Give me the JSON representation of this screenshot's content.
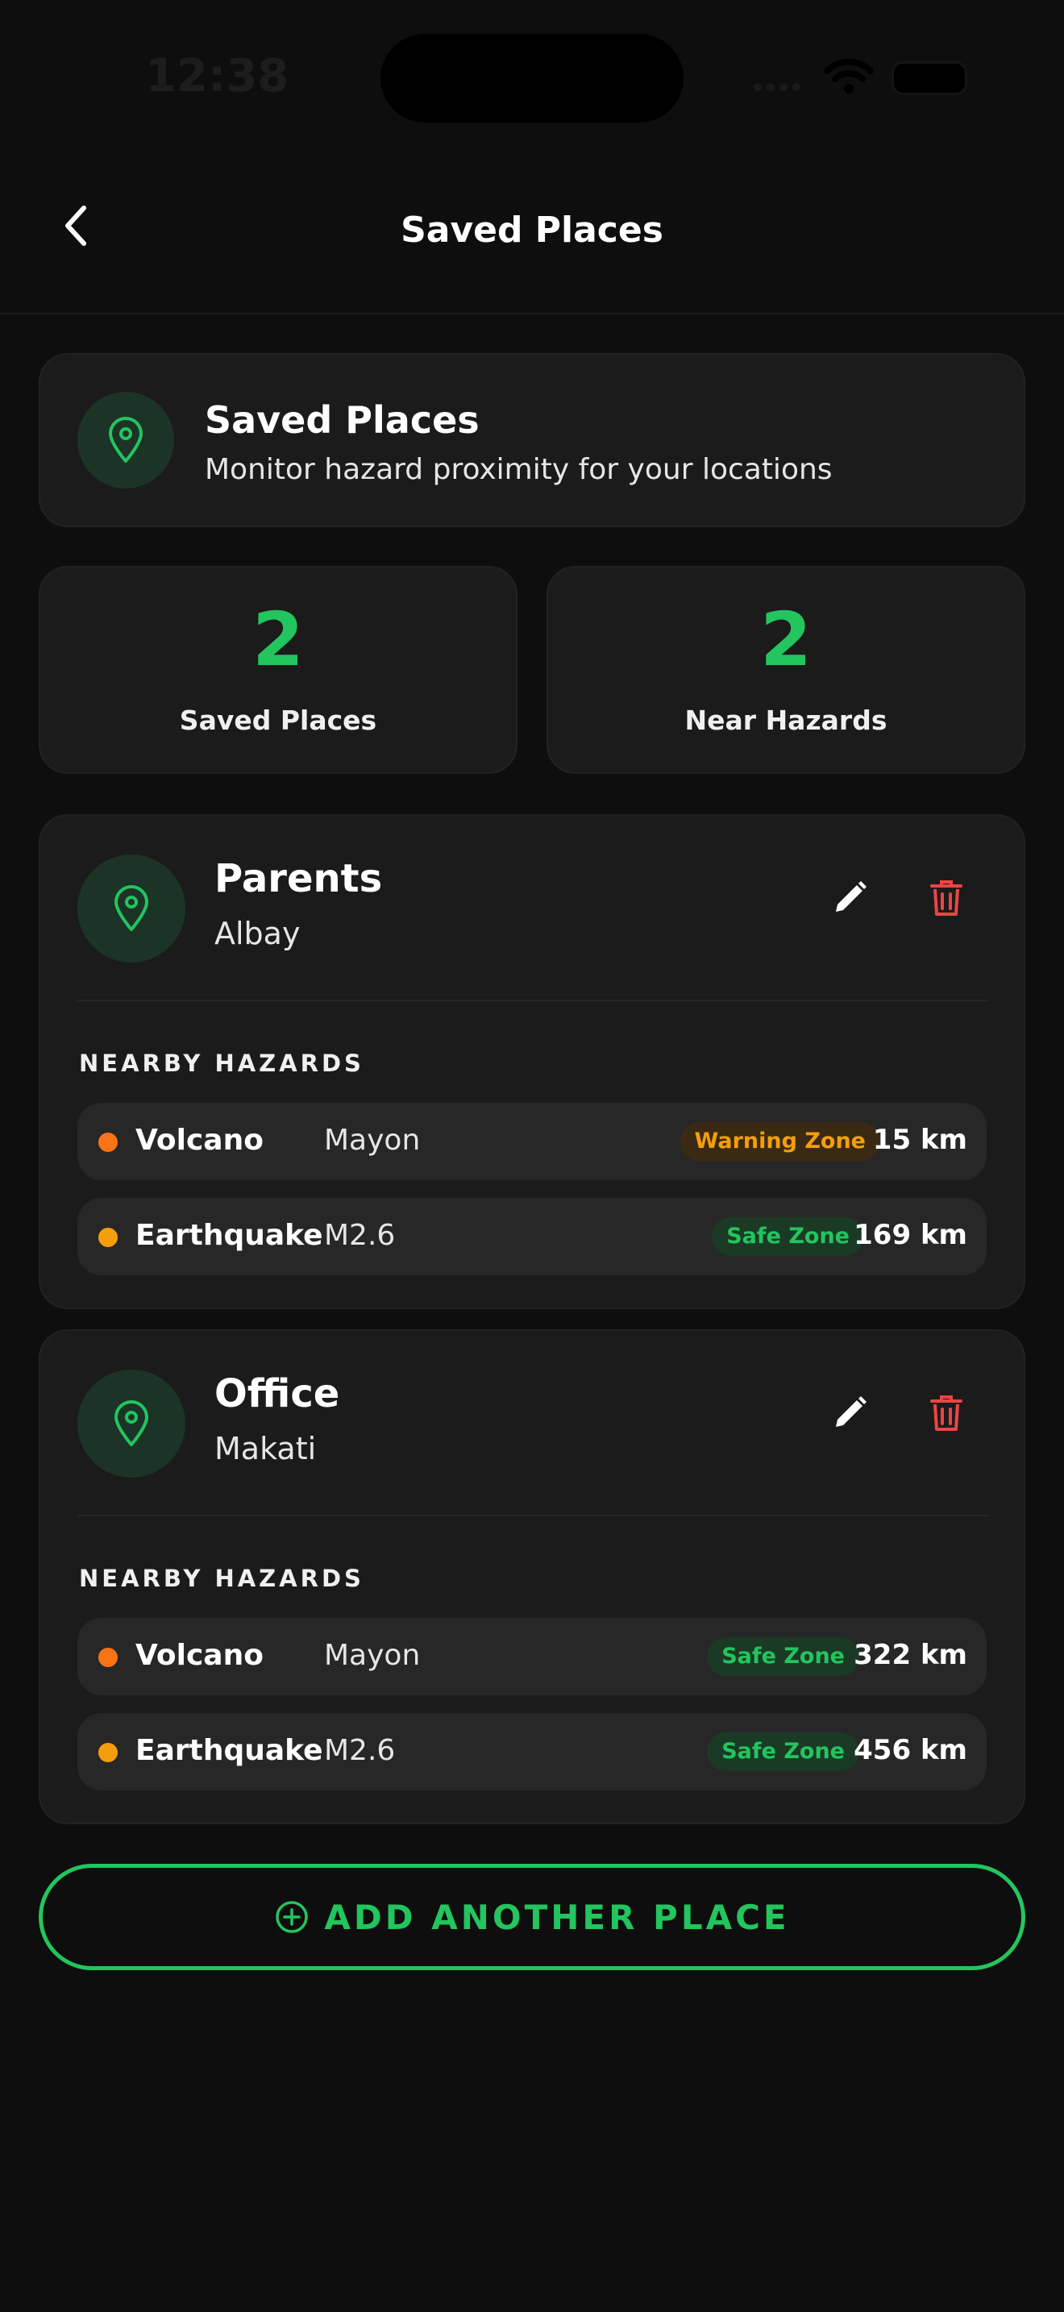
{
  "status_bar": {
    "time": "12:38"
  },
  "nav": {
    "title": "Saved Places"
  },
  "header": {
    "title": "Saved Places",
    "subtitle": "Monitor hazard proximity for your locations"
  },
  "stats": [
    {
      "value": "2",
      "label": "Saved Places"
    },
    {
      "value": "2",
      "label": "Near Hazards"
    }
  ],
  "places": [
    {
      "name": "Parents",
      "location": "Albay",
      "section_label": "NEARBY HAZARDS",
      "hazards": [
        {
          "type": "Volcano",
          "name": "Mayon",
          "zone": "Warning Zone",
          "distance": "15 km",
          "dot_color": "#f97316"
        },
        {
          "type": "Earthquake",
          "name": "M2.6",
          "zone": "Safe Zone",
          "distance": "169 km",
          "dot_color": "#f59e0b"
        }
      ]
    },
    {
      "name": "Office",
      "location": "Makati",
      "section_label": "NEARBY HAZARDS",
      "hazards": [
        {
          "type": "Volcano",
          "name": "Mayon",
          "zone": "Safe Zone",
          "distance": "322 km",
          "dot_color": "#f97316"
        },
        {
          "type": "Earthquake",
          "name": "M2.6",
          "zone": "Safe Zone",
          "distance": "456 km",
          "dot_color": "#f59e0b"
        }
      ]
    }
  ],
  "add_button": {
    "label": "ADD ANOTHER PLACE"
  },
  "colors": {
    "accent": "#22c55e",
    "warning": "#f59e0b",
    "danger": "#ef4444",
    "background": "#0e0e0e",
    "card": "#1b1b1b"
  },
  "icons": {
    "back": "chevron-left-icon",
    "pin": "map-pin-icon",
    "edit": "pencil-icon",
    "delete": "trash-icon",
    "add": "plus-circle-icon"
  }
}
